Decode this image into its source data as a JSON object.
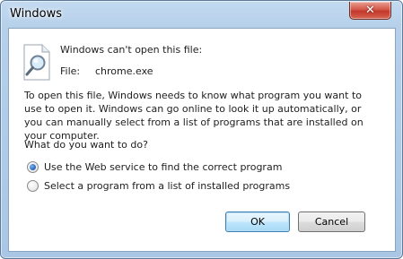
{
  "window": {
    "title": "Windows",
    "close_glyph": "✕"
  },
  "message": {
    "headline": "Windows can't open this file:",
    "file_label": "File:",
    "file_name": "chrome.exe",
    "body": "To open this file, Windows needs to know what program you want to use to open it. Windows can go online to look it up automatically, or you can manually select from a list of programs that are installed on your computer.",
    "question": "What do you want to do?",
    "icon": "search-document-icon"
  },
  "options": [
    {
      "label": "Use the Web service to find the correct program",
      "checked": true
    },
    {
      "label": "Select a program from a list of installed programs",
      "checked": false
    }
  ],
  "buttons": {
    "ok_label": "OK",
    "cancel_label": "Cancel"
  },
  "colors": {
    "frame": "#b6d0ea",
    "close_button": "#c2382b",
    "radio_selected": "#2b6fbf"
  }
}
